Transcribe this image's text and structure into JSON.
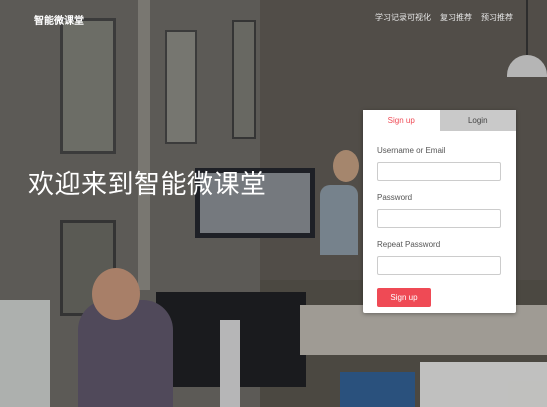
{
  "header": {
    "brand": "智能微课堂",
    "nav": [
      "学习记录可视化",
      "复习推荐",
      "预习推荐"
    ]
  },
  "hero": {
    "title": "欢迎来到智能微课堂"
  },
  "auth_card": {
    "tabs": [
      {
        "label": "Sign up",
        "active": true
      },
      {
        "label": "Login",
        "active": false
      }
    ],
    "fields": [
      {
        "label": "Username or Email",
        "value": ""
      },
      {
        "label": "Password",
        "value": ""
      },
      {
        "label": "Repeat Password",
        "value": ""
      }
    ],
    "submit_label": "Sign up"
  },
  "colors": {
    "accent": "#ef4a55",
    "tab_inactive": "#c9c9c9"
  }
}
